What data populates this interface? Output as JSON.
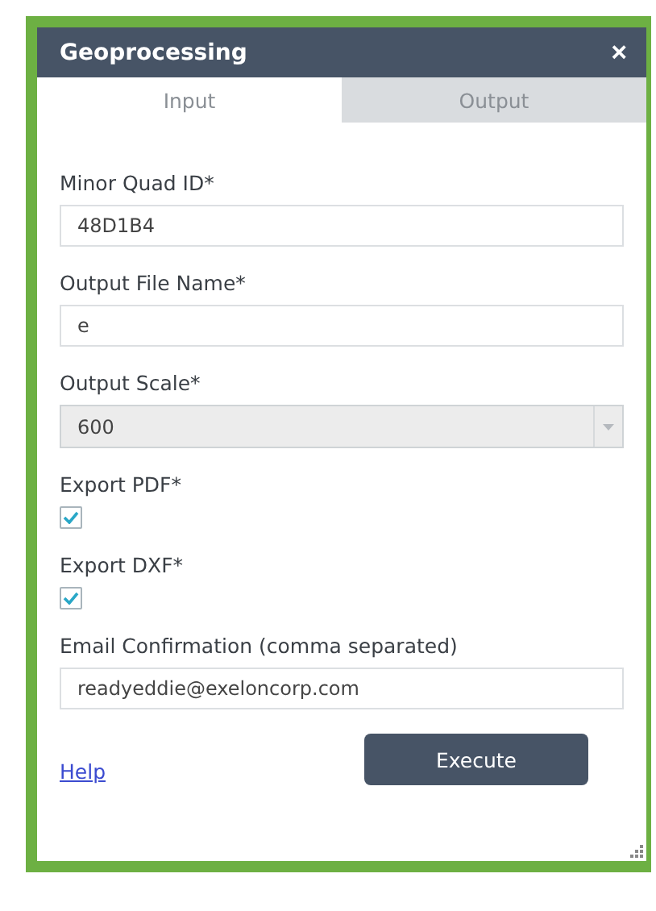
{
  "window": {
    "title": "Geoprocessing",
    "close": "×"
  },
  "tabs": [
    {
      "label": "Input",
      "selected": true
    },
    {
      "label": "Output",
      "selected": false
    }
  ],
  "fields": [
    {
      "kind": "text",
      "label": "Minor Quad ID*",
      "value": "48D1B4"
    },
    {
      "kind": "text",
      "label": "Output File Name*",
      "value": "e"
    },
    {
      "kind": "select",
      "label": "Output Scale*",
      "value": "600"
    },
    {
      "kind": "checkbox",
      "label": "Export PDF*",
      "checked": true
    },
    {
      "kind": "checkbox",
      "label": "Export DXF*",
      "checked": true
    },
    {
      "kind": "text",
      "label": "Email Confirmation (comma separated)",
      "value": "readyeddie@exeloncorp.com"
    }
  ],
  "help_link": "Help",
  "execute_button": "Execute"
}
